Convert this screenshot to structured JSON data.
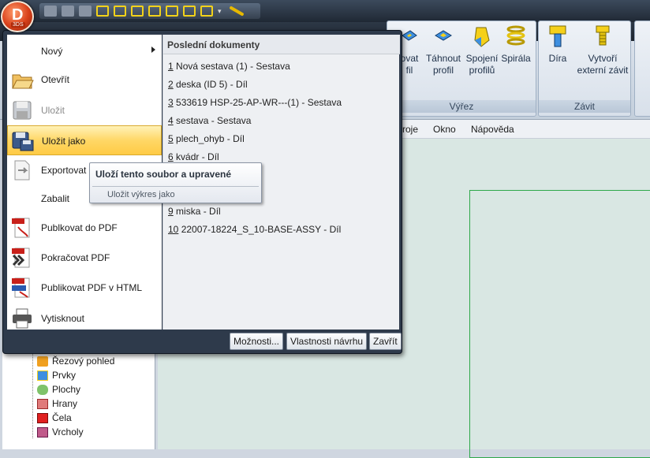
{
  "ribbon": {
    "groups": [
      {
        "label": "Výřez"
      },
      {
        "label": "Závit"
      }
    ],
    "tools": [
      {
        "label1": "ovat",
        "label2": "fil"
      },
      {
        "label1": "Táhnout",
        "label2": "profil"
      },
      {
        "label1": "Spojení",
        "label2": "profilů"
      },
      {
        "label1": "Spirála",
        "label2": ""
      },
      {
        "label1": "Díra",
        "label2": ""
      },
      {
        "label1": "Vytvoří",
        "label2": "externí závit"
      }
    ]
  },
  "menubar": {
    "items": [
      "roje",
      "Okno",
      "Nápověda"
    ]
  },
  "file_menu": {
    "items": [
      {
        "label": "Nový",
        "icon": "new-icon",
        "state": "normal",
        "submenu": true
      },
      {
        "label": "Otevřít",
        "icon": "open-folder-icon",
        "state": "normal"
      },
      {
        "label": "Uložit",
        "icon": "save-icon",
        "state": "disabled"
      },
      {
        "label": "Uložit jako",
        "icon": "save-as-icon",
        "state": "active"
      },
      {
        "label": "Exportovat",
        "icon": "export-icon",
        "state": "normal"
      },
      {
        "label": "Zabalit",
        "icon": "",
        "state": "normal"
      },
      {
        "label": "Publkovat do PDF",
        "icon": "pdf-icon",
        "state": "normal"
      },
      {
        "label": "Pokračovat PDF",
        "icon": "pdf-continue-icon",
        "state": "normal"
      },
      {
        "label": "Publikovat PDF v HTML",
        "icon": "pdf-html-icon",
        "state": "normal"
      },
      {
        "label": "Vytisknout",
        "icon": "printer-icon",
        "state": "normal"
      }
    ],
    "recent_title": "Poslední dokumenty",
    "recent": [
      {
        "num": "1",
        "text": "Nová sestava (1) - Sestava"
      },
      {
        "num": "2",
        "text": "deska (ID 5) - Díl"
      },
      {
        "num": "3",
        "text": "533619 HSP-25-AP-WR---(1) - Sestava"
      },
      {
        "num": "4",
        "text": "sestava - Sestava"
      },
      {
        "num": "5",
        "text": "plech_ohyb - Díl"
      },
      {
        "num": "6",
        "text": "kvádr - Díl"
      },
      {
        "num": "9",
        "text": "miska - Díl"
      },
      {
        "num": "10",
        "text": "22007-18224_S_10-BASE-ASSY - Díl"
      }
    ],
    "footer_buttons": [
      "Možnosti...",
      "Vlastnosti návrhu",
      "Zavřít"
    ]
  },
  "tooltip": {
    "title": "Uloží tento soubor a upravené",
    "description": "Uložit výkres jako"
  },
  "tree": {
    "items": [
      "Řezový pohled",
      "Prvky",
      "Plochy",
      "Hrany",
      "Čela",
      "Vrcholy"
    ]
  },
  "app_logo": {
    "letter": "D",
    "sub": "3DS"
  },
  "colors": {
    "active_item": "#ffd766",
    "accent_green": "#2ea84a",
    "app_button": "#d8401a"
  }
}
